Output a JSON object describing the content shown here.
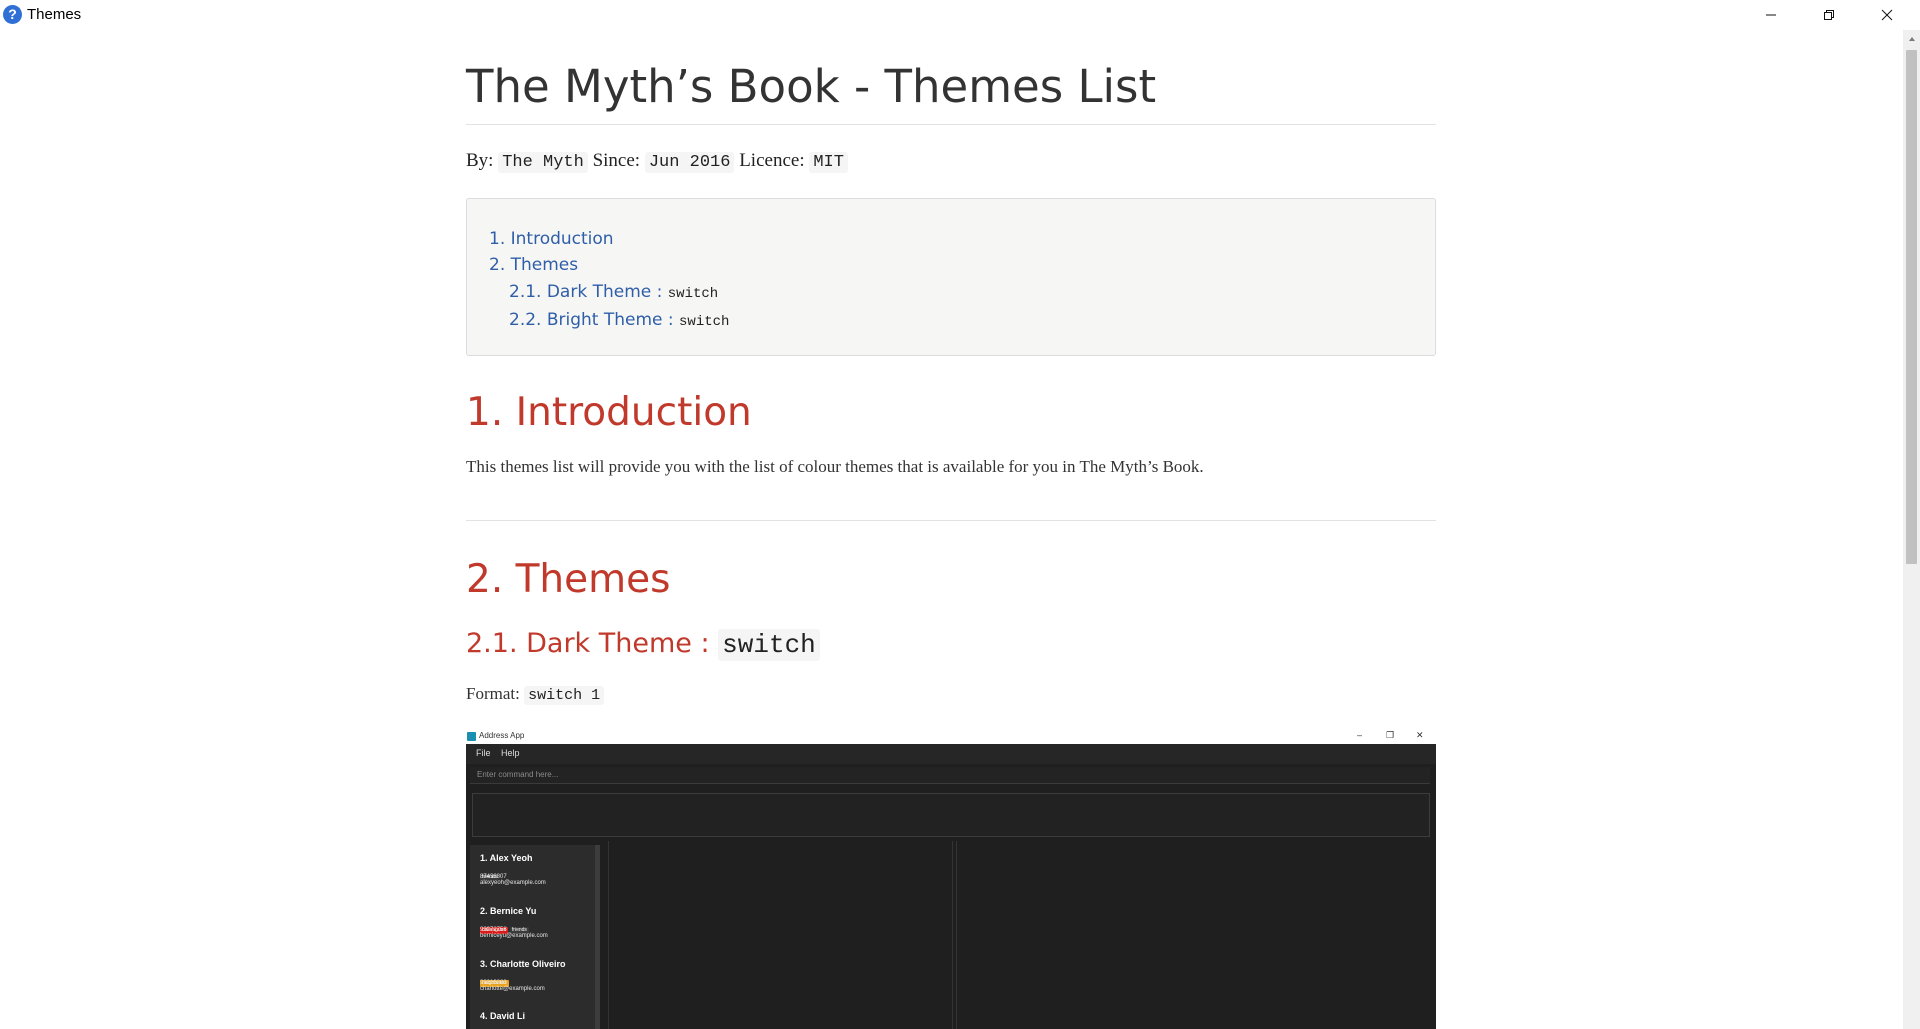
{
  "window": {
    "title": "Themes",
    "icon": "help-icon",
    "controls": [
      "minimize-icon",
      "restore-icon",
      "close-icon"
    ]
  },
  "doc": {
    "title": "The Myth’s Book - Themes List",
    "meta": {
      "by_label": "By:",
      "by_value": "The Myth",
      "since_label": "Since:",
      "since_value": "Jun 2016",
      "licence_label": "Licence:",
      "licence_value": "MIT"
    },
    "toc": {
      "items": [
        {
          "label": "1. Introduction"
        },
        {
          "label": "2. Themes"
        },
        {
          "label": "2.1. Dark Theme :",
          "code": "switch"
        },
        {
          "label": "2.2. Bright Theme :",
          "code": "switch"
        }
      ]
    },
    "intro": {
      "heading": "1. Introduction",
      "text": "This themes list will provide you with the list of colour themes that is available for you in The Myth’s Book."
    },
    "themes": {
      "heading": "2. Themes",
      "dark": {
        "heading": "2.1. Dark Theme :",
        "heading_code": "switch",
        "format_label": "Format:",
        "format_code": "switch 1"
      }
    }
  },
  "screenshot": {
    "app_title": "Address App",
    "menu": [
      "File",
      "Help"
    ],
    "command_placeholder": "Enter command here...",
    "persons": [
      {
        "index": "1.",
        "name": "Alex Yeoh",
        "tags": [
          {
            "label": "friends",
            "kind": "friends"
          }
        ],
        "phone": "87438807",
        "email": "alexyeoh@example.com"
      },
      {
        "index": "2.",
        "name": "Bernice Yu",
        "tags": [
          {
            "label": "colleagues",
            "kind": "colleagues"
          },
          {
            "label": "friends",
            "kind": "friends"
          }
        ],
        "phone": "99272758",
        "email": "berniceyu@example.com"
      },
      {
        "index": "3.",
        "name": "Charlotte Oliveiro",
        "tags": [
          {
            "label": "neighbours",
            "kind": "neighbours"
          }
        ],
        "phone": "93210283",
        "email": "charlotte@example.com"
      },
      {
        "index": "4.",
        "name": "David Li",
        "tags": [],
        "phone": "",
        "email": ""
      }
    ]
  },
  "colors": {
    "heading_red": "#c0392b",
    "link_blue": "#2f5ea8",
    "dark_bg": "#1f1f1f"
  }
}
